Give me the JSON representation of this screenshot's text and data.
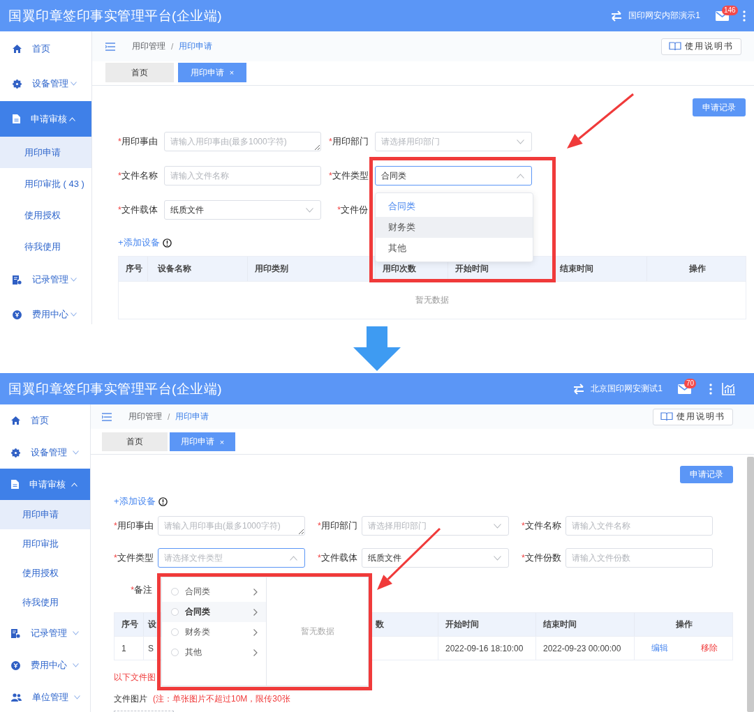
{
  "screens": [
    {
      "header": {
        "title": "国翼印章签印事实管理平台(企业端)",
        "user": "国印网安内部演示1",
        "mail_count": "146",
        "icons": [
          {
            "kind": "more"
          }
        ]
      },
      "sidebar": [
        {
          "label": "首页",
          "kind": "home",
          "selected": false
        },
        {
          "label": "设备管理",
          "kind": "gear",
          "selected": false,
          "expanded": false
        },
        {
          "label": "申请审核",
          "kind": "doc",
          "selected": true,
          "expanded": true,
          "children": [
            {
              "label": "用印申请",
              "selected": true
            },
            {
              "label": "用印审批 ( 43 )",
              "selected": false
            },
            {
              "label": "使用授权",
              "selected": false
            },
            {
              "label": "待我使用",
              "selected": false
            }
          ]
        },
        {
          "label": "记录管理",
          "kind": "record",
          "selected": false,
          "expanded": false
        },
        {
          "label": "费用中心",
          "kind": "coin",
          "selected": false,
          "expanded": false
        }
      ],
      "breadcrumb": {
        "items": [
          "用印管理",
          "用印申请"
        ],
        "separator": "/"
      },
      "manual_button": "使用说明书",
      "tabs": [
        {
          "label": "首页",
          "selected": false
        },
        {
          "label": "用印申请",
          "selected": true,
          "close": "×"
        }
      ],
      "record_button": "申请记录",
      "add_device": "+添加设备",
      "fields": [
        {
          "mark": "*",
          "label": "用印事由",
          "kind": "textarea",
          "placeholder": "请输入用印事由(最多1000字符)"
        },
        {
          "mark": "*",
          "label": "用印部门",
          "kind": "select",
          "placeholder": "请选择用印部门",
          "open": false
        },
        {
          "mark": "*",
          "label": "文件名称",
          "kind": "input",
          "placeholder": "请输入文件名称"
        },
        {
          "mark": "*",
          "label": "文件类型",
          "kind": "select",
          "value": "合同类",
          "open": true
        },
        {
          "mark": "*",
          "label": "文件载体",
          "kind": "select",
          "value": "纸质文件",
          "open": false
        },
        {
          "mark": "*",
          "label": "文件份",
          "kind": "label"
        }
      ],
      "dropdown": {
        "kind": "list",
        "options": [
          {
            "label": "合同类",
            "selected": true,
            "hovered": false
          },
          {
            "label": "财务类",
            "selected": false,
            "hovered": true
          },
          {
            "label": "其他",
            "selected": false,
            "hovered": false
          }
        ]
      },
      "table": {
        "columns": [
          "序号",
          "设备名称",
          "用印类别",
          "用印次数",
          "开始时间",
          "结束时间",
          "操作"
        ],
        "empty_text": "暂无数据"
      }
    },
    {
      "header": {
        "title": "国翼印章签印事实管理平台(企业端)",
        "user": "北京国印网安测试1",
        "mail_count": "70",
        "icons": [
          {
            "kind": "more"
          },
          {
            "kind": "chart"
          }
        ]
      },
      "sidebar": [
        {
          "label": "首页",
          "kind": "home",
          "selected": false
        },
        {
          "label": "设备管理",
          "kind": "gear",
          "selected": false,
          "expanded": false
        },
        {
          "label": "申请审核",
          "kind": "doc",
          "selected": true,
          "expanded": true,
          "children": [
            {
              "label": "用印申请",
              "selected": true
            },
            {
              "label": "用印审批",
              "selected": false
            },
            {
              "label": "使用授权",
              "selected": false
            },
            {
              "label": "待我使用",
              "selected": false
            }
          ]
        },
        {
          "label": "记录管理",
          "kind": "record",
          "selected": false,
          "expanded": false
        },
        {
          "label": "费用中心",
          "kind": "coin",
          "selected": false,
          "expanded": false
        },
        {
          "label": "单位管理",
          "kind": "people",
          "selected": false,
          "expanded": false
        }
      ],
      "breadcrumb": {
        "items": [
          "用印管理",
          "用印申请"
        ],
        "separator": "/"
      },
      "manual_button": "使用说明书",
      "tabs": [
        {
          "label": "首页",
          "selected": false
        },
        {
          "label": "用印申请",
          "selected": true,
          "close": "×"
        }
      ],
      "record_button": "申请记录",
      "add_device": "+添加设备",
      "fields": [
        {
          "mark": "*",
          "label": "用印事由",
          "kind": "textarea",
          "placeholder": "请输入用印事由(最多1000字符)"
        },
        {
          "mark": "*",
          "label": "用印部门",
          "kind": "select",
          "placeholder": "请选择用印部门",
          "open": false
        },
        {
          "mark": "*",
          "label": "文件名称",
          "kind": "input",
          "placeholder": "请输入文件名称"
        },
        {
          "mark": "*",
          "label": "文件类型",
          "kind": "select",
          "placeholder": "请选择文件类型",
          "open": true
        },
        {
          "mark": "*",
          "label": "文件载体",
          "kind": "select",
          "value": "纸质文件",
          "open": false
        },
        {
          "mark": "*",
          "label": "文件份数",
          "kind": "input",
          "placeholder": "请输入文件份数"
        },
        {
          "mark": "*",
          "label": "备注",
          "kind": "label"
        }
      ],
      "dropdown": {
        "kind": "cascader",
        "options": [
          {
            "label": "合同类",
            "checked": false,
            "hovered": false
          },
          {
            "label": "合同类",
            "checked": false,
            "hovered": true
          },
          {
            "label": "财务类",
            "checked": false,
            "hovered": false
          },
          {
            "label": "其他",
            "checked": false,
            "hovered": false
          }
        ],
        "empty_text": "暂无数据"
      },
      "table": {
        "columns": [
          "序号",
          "设",
          null,
          "数",
          "开始时间",
          "结束时间",
          "操作"
        ],
        "rows": [
          {
            "cells": [
              "1",
              "S",
              null,
              null,
              "2022-09-16 18:10:00",
              "2022-09-23 00:00:00"
            ],
            "actions": [
              {
                "label": "编辑",
                "kind": "edit"
              },
              {
                "label": "移除",
                "kind": "remove"
              }
            ]
          }
        ]
      },
      "notice": "以下文件图",
      "upload": {
        "label": "文件图片",
        "hint": "(注：单张图片不超过10M，限传30张"
      }
    }
  ]
}
